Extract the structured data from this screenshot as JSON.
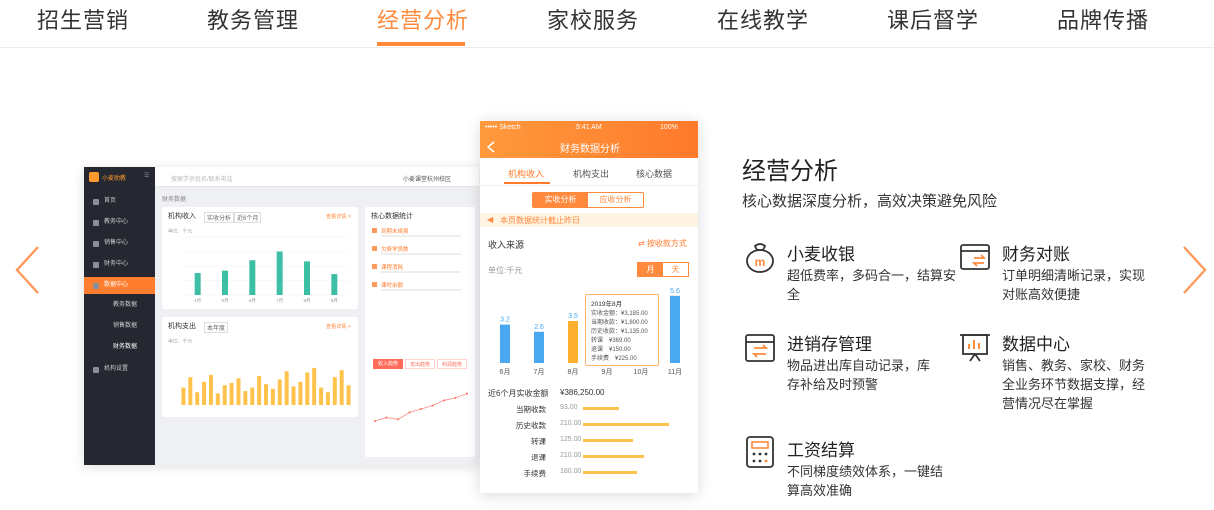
{
  "tabs": [
    "招生营销",
    "教务管理",
    "经营分析",
    "家校服务",
    "在线教学",
    "课后督学",
    "品牌传播"
  ],
  "active_tab": "经营分析",
  "colors": {
    "accent": "#ff8a3d",
    "chart_green": "#3dbfa6",
    "chart_yellow": "#ffc34d",
    "chart_blue": "#4aa8f0",
    "chart_orange": "#ffb02e"
  },
  "dashboard": {
    "brand": "小麦助教",
    "search_placeholder": "搜索学员姓名/联系电话",
    "campus": "小麦课堂杭州校区",
    "breadcrumb": "财务数据",
    "menu": [
      {
        "label": "首页",
        "icon": "home-icon"
      },
      {
        "label": "教务中心",
        "icon": "book-icon"
      },
      {
        "label": "销售中心",
        "icon": "tag-icon"
      },
      {
        "label": "财务中心",
        "icon": "wallet-icon"
      },
      {
        "label": "数据中心",
        "icon": "chart-icon",
        "active": true
      },
      {
        "label": "教务数据",
        "sub": true
      },
      {
        "label": "销售数据",
        "sub": true
      },
      {
        "label": "财务数据",
        "sub": true,
        "current": true
      },
      {
        "label": "机构设置",
        "icon": "building-icon"
      }
    ],
    "income_card": {
      "title": "机构收入",
      "filter1": "实收分析",
      "filter2": "近6个月",
      "link": "查看详情 >",
      "unit": "单位：千元",
      "categories": [
        "4月",
        "5月",
        "6月",
        "7月",
        "8月",
        "9月"
      ],
      "values": [
        38,
        42,
        60,
        75,
        58,
        36
      ],
      "ylim": [
        0,
        100
      ]
    },
    "expense_card": {
      "title": "机构支出",
      "filter1": "本年度",
      "link": "查看详情 >",
      "unit": "单位：千元",
      "values": [
        30,
        48,
        22,
        40,
        52,
        20,
        34,
        38,
        46,
        24,
        30,
        50,
        36,
        28,
        44,
        58,
        32,
        40,
        56,
        64,
        30,
        22,
        48,
        60,
        34
      ],
      "ylim": [
        0,
        100
      ]
    },
    "stats_card": {
      "title": "核心数据统计",
      "items": [
        "到期未续费",
        "欠费学员数",
        "课程消耗",
        "课时余额"
      ],
      "tabs": [
        "收入趋势",
        "支出趋势",
        "利润趋势"
      ],
      "line_values": [
        28,
        32,
        30,
        38,
        42,
        46,
        52,
        55,
        60
      ]
    }
  },
  "phone": {
    "status": {
      "carrier": "••••• Sketch",
      "time": "9:41 AM",
      "battery": "100%"
    },
    "title": "财务数据分析",
    "tabs": [
      "机构收入",
      "机构支出",
      "核心数据"
    ],
    "seg": [
      "实收分析",
      "应收分析"
    ],
    "notice": "本页数据统计截止昨日",
    "income_label": "收入来源",
    "sort_label": "按收款方式",
    "unit": "单位:千元",
    "period_tabs": [
      "月",
      "天"
    ],
    "chart_data": {
      "type": "bar",
      "categories": [
        "6月",
        "7月",
        "8月",
        "9月",
        "10月",
        "11月"
      ],
      "values": [
        3.2,
        2.6,
        3.5,
        2.4,
        2.9,
        5.6
      ],
      "labels": [
        "3.2",
        "2.6",
        "3.5",
        "",
        "",
        "5.6"
      ],
      "highlight_index": 2
    },
    "tooltip": {
      "title": "2019年8月",
      "lines": [
        "实收金额：¥3,185.00",
        "当期收款：¥1,800.00",
        "历史收款：¥1,135.00",
        "转课　¥369.00",
        "退课　¥150.00",
        "手续费　¥225.00"
      ]
    },
    "total_label": "近6个月实收金额",
    "total_value": "¥386,250.00",
    "breakdown": [
      {
        "name": "当期收款",
        "value": "93.00",
        "frac": 0.38
      },
      {
        "name": "历史收款",
        "value": "210.00",
        "frac": 0.9
      },
      {
        "name": "转课",
        "value": "125.00",
        "frac": 0.52
      },
      {
        "name": "退课",
        "value": "210.00",
        "frac": 0.64
      },
      {
        "name": "手续费",
        "value": "180.00",
        "frac": 0.56
      }
    ]
  },
  "section": {
    "title": "经营分析",
    "subtitle": "核心数据深度分析，高效决策避免风险",
    "features": [
      {
        "title": "小麦收银",
        "desc": "超低费率，多码合一，结算安全",
        "icon": "cashier-bag-icon"
      },
      {
        "title": "财务对账",
        "desc": "订单明细清晰记录，实现对账高效便捷",
        "icon": "reconcile-icon"
      },
      {
        "title": "进销存管理",
        "desc": "物品进出库自动记录，库存补给及时预警",
        "icon": "inventory-box-icon"
      },
      {
        "title": "数据中心",
        "desc": "销售、教务、家校、财务全业务环节数据支撑，经营情况尽在掌握",
        "icon": "presentation-chart-icon"
      },
      {
        "title": "工资结算",
        "desc": "不同梯度绩效体系，一键结算高效准确",
        "icon": "calculator-icon"
      }
    ]
  }
}
